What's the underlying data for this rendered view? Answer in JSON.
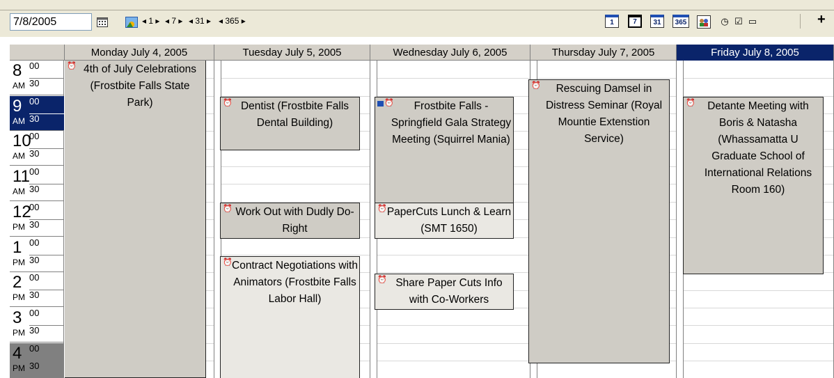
{
  "toolbar": {
    "date_value": "7/8/2005",
    "nav": [
      {
        "label": "1"
      },
      {
        "label": "7"
      },
      {
        "label": "31"
      },
      {
        "label": "365"
      }
    ],
    "views": [
      "1",
      "7",
      "31",
      "365"
    ],
    "plus": "+"
  },
  "days": [
    {
      "label": "Monday July 4, 2005",
      "selected": false
    },
    {
      "label": "Tuesday July 5, 2005",
      "selected": false
    },
    {
      "label": "Wednesday July 6, 2005",
      "selected": false
    },
    {
      "label": "Thursday July 7, 2005",
      "selected": false
    },
    {
      "label": "Friday July 8, 2005",
      "selected": true
    }
  ],
  "hours": [
    {
      "hour": "8",
      "ampm": "AM",
      "m00": "00",
      "m30": "30",
      "style": "normal"
    },
    {
      "hour": "9",
      "ampm": "AM",
      "m00": "00",
      "m30": "30",
      "style": "current"
    },
    {
      "hour": "10",
      "ampm": "AM",
      "m00": "00",
      "m30": "30",
      "style": "normal"
    },
    {
      "hour": "11",
      "ampm": "AM",
      "m00": "00",
      "m30": "30",
      "style": "normal"
    },
    {
      "hour": "12",
      "ampm": "PM",
      "m00": "00",
      "m30": "30",
      "style": "normal"
    },
    {
      "hour": "1",
      "ampm": "PM",
      "m00": "00",
      "m30": "30",
      "style": "normal"
    },
    {
      "hour": "2",
      "ampm": "PM",
      "m00": "00",
      "m30": "30",
      "style": "normal"
    },
    {
      "hour": "3",
      "ampm": "PM",
      "m00": "00",
      "m30": "30",
      "style": "normal"
    },
    {
      "hour": "4",
      "ampm": "PM",
      "m00": "00",
      "m30": "30",
      "style": "dim"
    }
  ],
  "events": [
    {
      "day": "Monday July 4, 2005",
      "start": "8:00",
      "end": "4:30+",
      "text": "4th of July Celebrations (Frostbite Falls State Park)",
      "icon": "bell-icon",
      "tone": "dark"
    },
    {
      "day": "Tuesday July 5, 2005",
      "start": "9:00",
      "end": "10:00",
      "text": "Dentist  (Frostbite Falls Dental Building)",
      "icon": "bell-icon",
      "tone": "dark"
    },
    {
      "day": "Tuesday July 5, 2005",
      "start": "12:00",
      "end": "1:00",
      "text": "Work Out with Dudly Do-Right",
      "icon": "bell-icon",
      "tone": "dark"
    },
    {
      "day": "Tuesday July 5, 2005",
      "start": "1:30",
      "end": "4:30+",
      "text": "Contract Negotiations with Animators (Frostbite Falls Labor Hall)",
      "icon": "bell-icon",
      "tone": "light"
    },
    {
      "day": "Wednesday July 6, 2005",
      "start": "9:00",
      "end": "12:00",
      "text": "Frostbite Falls - Springfield Gala Strategy Meeting (Squirrel Mania)",
      "icon": "people-bell-icon",
      "tone": "dark"
    },
    {
      "day": "Wednesday July 6, 2005",
      "start": "12:00",
      "end": "1:00",
      "text": "PaperCuts Lunch & Learn (SMT 1650)",
      "icon": "bell-icon",
      "tone": "light"
    },
    {
      "day": "Wednesday July 6, 2005",
      "start": "2:00",
      "end": "3:00",
      "text": "Share Paper Cuts Info with Co-Workers",
      "icon": "bell-icon",
      "tone": "light"
    },
    {
      "day": "Thursday July 7, 2005",
      "start": "8:30",
      "end": "4:30",
      "text": "Rescuing Damsel in Distress Seminar (Royal Mountie Extenstion Service)",
      "icon": "bell-icon",
      "tone": "dark"
    },
    {
      "day": "Friday July 8, 2005",
      "start": "9:00",
      "end": "2:00",
      "text": "Detante Meeting with Boris & Natasha (Whassamatta U Graduate School of International Relations Room 160)",
      "icon": "bell-icon",
      "tone": "dark"
    }
  ]
}
